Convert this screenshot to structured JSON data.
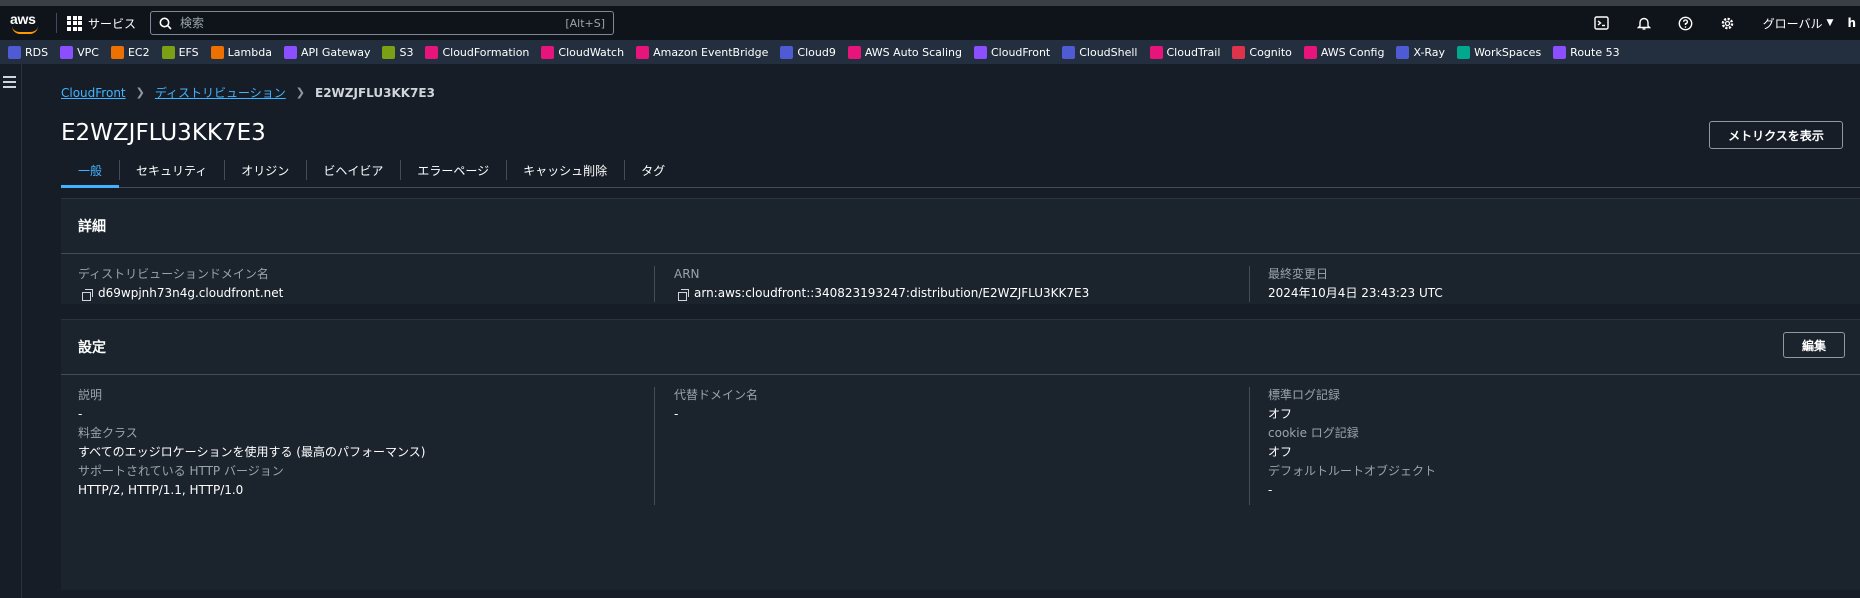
{
  "nav": {
    "logo": "aws",
    "services_label": "サービス",
    "search_placeholder": "検索",
    "search_shortcut": "[Alt+S]",
    "region": "グローバル",
    "account": "h"
  },
  "favorites": [
    {
      "label": "RDS",
      "color": "#4f5bd5"
    },
    {
      "label": "VPC",
      "color": "#8c4fff"
    },
    {
      "label": "EC2",
      "color": "#ed7100"
    },
    {
      "label": "EFS",
      "color": "#7aa116"
    },
    {
      "label": "Lambda",
      "color": "#ed7100"
    },
    {
      "label": "API Gateway",
      "color": "#8c4fff"
    },
    {
      "label": "S3",
      "color": "#7aa116"
    },
    {
      "label": "CloudFormation",
      "color": "#e7157b"
    },
    {
      "label": "CloudWatch",
      "color": "#e7157b"
    },
    {
      "label": "Amazon EventBridge",
      "color": "#e7157b"
    },
    {
      "label": "Cloud9",
      "color": "#4f5bd5"
    },
    {
      "label": "AWS Auto Scaling",
      "color": "#e7157b"
    },
    {
      "label": "CloudFront",
      "color": "#8c4fff"
    },
    {
      "label": "CloudShell",
      "color": "#4f5bd5"
    },
    {
      "label": "CloudTrail",
      "color": "#e7157b"
    },
    {
      "label": "Cognito",
      "color": "#dd344c"
    },
    {
      "label": "AWS Config",
      "color": "#e7157b"
    },
    {
      "label": "X-Ray",
      "color": "#4f5bd5"
    },
    {
      "label": "WorkSpaces",
      "color": "#01a88d"
    },
    {
      "label": "Route 53",
      "color": "#8c4fff"
    }
  ],
  "breadcrumb": {
    "root": "CloudFront",
    "section": "ディストリビューション",
    "current": "E2WZJFLU3KK7E3"
  },
  "page": {
    "title": "E2WZJFLU3KK7E3",
    "metrics_button": "メトリクスを表示"
  },
  "tabs": [
    {
      "label": "一般",
      "active": true
    },
    {
      "label": "セキュリティ",
      "active": false
    },
    {
      "label": "オリジン",
      "active": false
    },
    {
      "label": "ビヘイビア",
      "active": false
    },
    {
      "label": "エラーページ",
      "active": false
    },
    {
      "label": "キャッシュ削除",
      "active": false
    },
    {
      "label": "タグ",
      "active": false
    }
  ],
  "details": {
    "heading": "詳細",
    "domain_label": "ディストリビューションドメイン名",
    "domain_value": "d69wpjnh73n4g.cloudfront.net",
    "arn_label": "ARN",
    "arn_value": "arn:aws:cloudfront::340823193247:distribution/E2WZJFLU3KK7E3",
    "modified_label": "最終変更日",
    "modified_value": "2024年10月4日 23:43:23 UTC"
  },
  "settings": {
    "heading": "設定",
    "edit_button": "編集",
    "description_label": "説明",
    "description_value": "-",
    "price_class_label": "料金クラス",
    "price_class_value": "すべてのエッジロケーションを使用する (最高のパフォーマンス)",
    "http_label": "サポートされている HTTP バージョン",
    "http_value": "HTTP/2, HTTP/1.1, HTTP/1.0",
    "alt_domain_label": "代替ドメイン名",
    "alt_domain_value": "-",
    "std_log_label": "標準ログ記録",
    "std_log_value": "オフ",
    "cookie_log_label": "cookie ログ記録",
    "cookie_log_value": "オフ",
    "default_root_label": "デフォルトルートオブジェクト",
    "default_root_value": "-"
  }
}
